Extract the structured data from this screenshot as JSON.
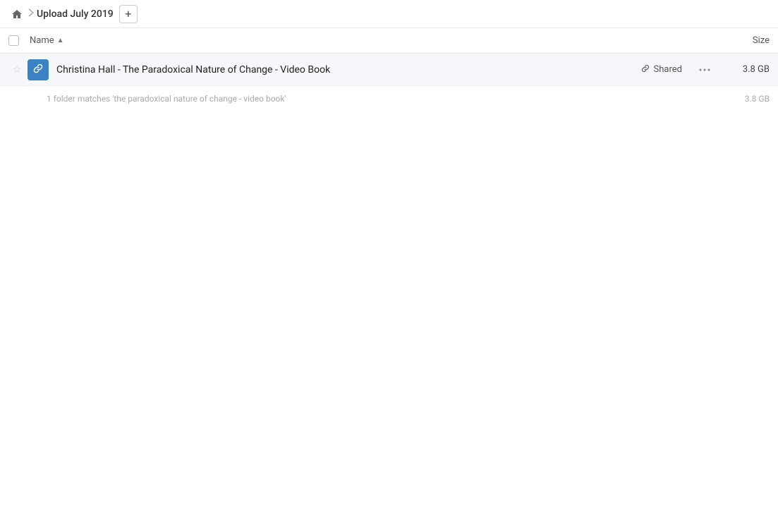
{
  "breadcrumb": {
    "home_label": "Home",
    "separator": ">",
    "current_path": "Upload July 2019",
    "add_button_label": "+"
  },
  "columns": {
    "name_label": "Name",
    "sort_indicator": "▲",
    "size_label": "Size"
  },
  "files": [
    {
      "id": 1,
      "name": "Christina Hall - The Paradoxical Nature of Change - Video Book",
      "shared_label": "Shared",
      "size": "3.8 GB",
      "starred": false,
      "has_link": true
    }
  ],
  "summary": {
    "text": "1 folder matches 'the paradoxical nature of change - video book'",
    "size": "3.8 GB"
  },
  "icons": {
    "home": "🏠",
    "link": "🔗",
    "more": "···",
    "star_empty": "☆"
  }
}
